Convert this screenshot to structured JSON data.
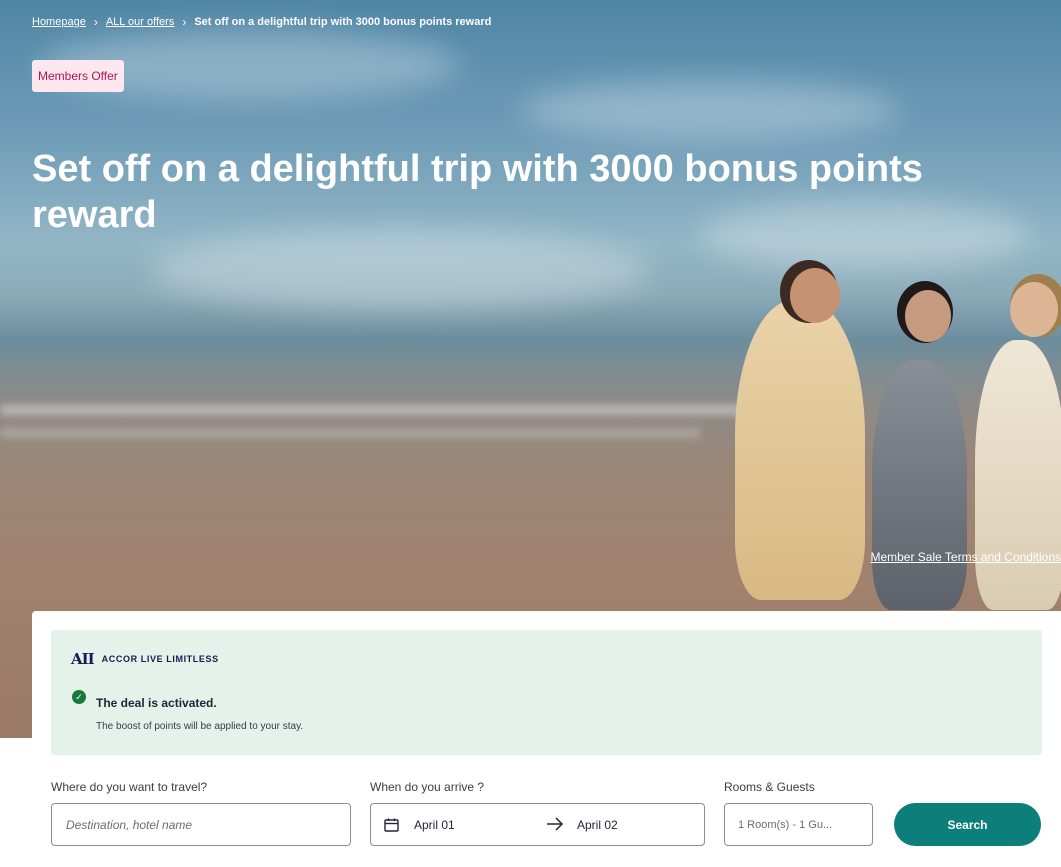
{
  "breadcrumb": {
    "items": [
      {
        "label": "Homepage"
      },
      {
        "label": "ALL our offers"
      }
    ],
    "current": "Set off on a delightful trip with 3000 bonus points reward"
  },
  "hero": {
    "badge": "Members Offer",
    "title": "Set off on a delightful trip with 3000 bonus points reward",
    "terms_link": "Member Sale Terms and Conditions"
  },
  "deal": {
    "brand_mark": "AII",
    "brand_name": "ACCOR LIVE LIMITLESS",
    "status": "The deal is activated.",
    "description": "The boost of points will be applied to your stay."
  },
  "search": {
    "destination": {
      "label": "Where do you want to travel?",
      "placeholder": "Destination, hotel name"
    },
    "dates": {
      "label": "When do you arrive ?",
      "check_in": "April 01",
      "check_out": "April 02"
    },
    "rooms": {
      "label": "Rooms & Guests",
      "value": "1 Room(s) - 1 Gu..."
    },
    "button": "Search"
  },
  "colors": {
    "badge_bg": "#fde8ef",
    "badge_text": "#b0154f",
    "deal_bg": "#e5f2ea",
    "check_green": "#167a3d",
    "brand_navy": "#1e1852",
    "search_button": "#0d7f7a"
  },
  "icons": [
    "chevron-right-icon",
    "check-circle-icon",
    "calendar-icon",
    "arrow-right-icon"
  ]
}
